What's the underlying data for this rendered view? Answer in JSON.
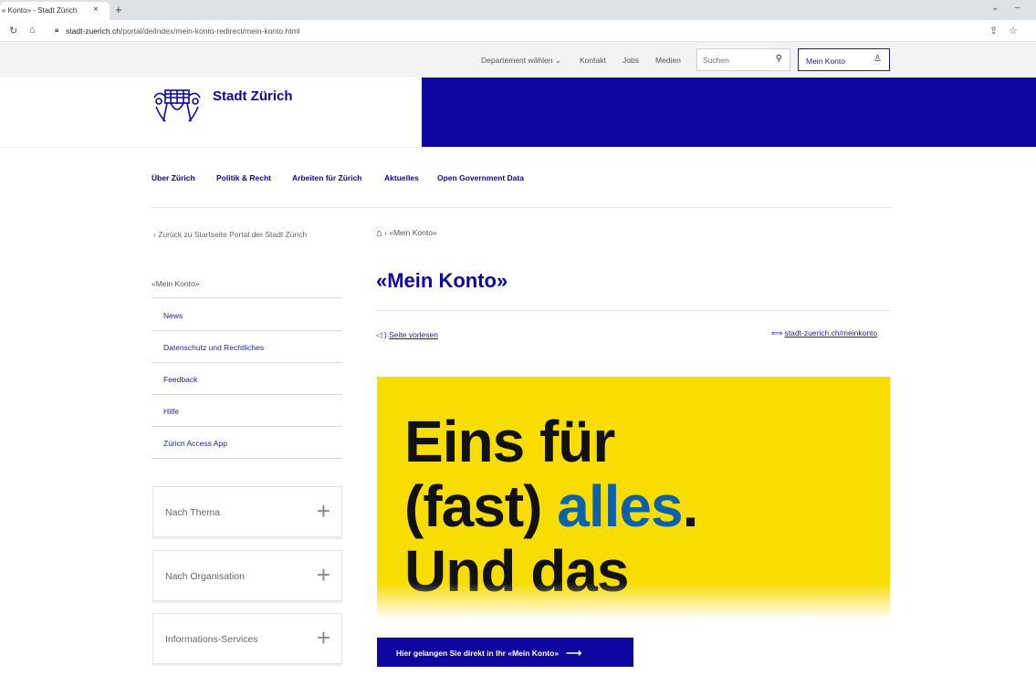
{
  "browser": {
    "tab_title": "« Konto» - Stadt Zürich",
    "tab_close": "×",
    "new_tab": "+",
    "url_host": "stadt-zuerich.ch",
    "url_path": "/portal/de/index/mein-konto-redirect/mein-konto.html"
  },
  "utility": {
    "department_label": "Departement wählen ⌄",
    "links": [
      "Kontakt",
      "Jobs",
      "Medien"
    ],
    "search_placeholder": "Suchen",
    "account_label": "Mein Konto"
  },
  "header": {
    "brand": "Stadt Zürich"
  },
  "mainnav": {
    "items": [
      "Über Zürich",
      "Politik & Recht",
      "Arbeiten für Zürich",
      "Aktuelles",
      "Open Government Data"
    ]
  },
  "sidebar": {
    "back_link": "‹  Zurück zu Startseite Portal der Stadt Zürich",
    "title": "«Mein Konto»",
    "items": [
      "News",
      "Datenschutz und Rechtliches",
      "Feedback",
      "Hilfe",
      "Züricn Access App"
    ],
    "accordions": [
      "Nach Thema",
      "Nach Organisation",
      "Informations-Services"
    ]
  },
  "main": {
    "breadcrumb_current": "«Mein Konto»",
    "title": "«Mein Konto»",
    "read_aloud": "Seite vorlesen",
    "short_url": "stadt-zuerich.ch/meinkonto",
    "hero": {
      "line1": "Eins für",
      "line2_a": "(fast) ",
      "line2_b": "alles",
      "line2_c": ".",
      "line3": "Und das"
    },
    "cta": "Hier gelangen Sie direkt in Ihr «Mein Konto»"
  }
}
